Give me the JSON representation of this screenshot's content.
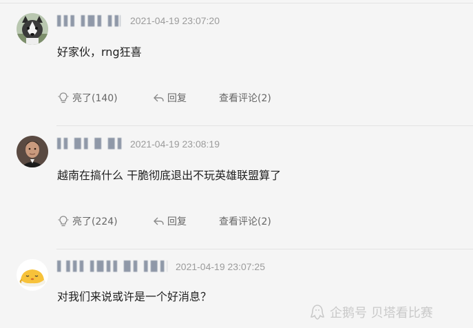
{
  "comments": [
    {
      "username": "▌▌▌▐▐▌▌▐▐ ▌ ▐",
      "time": "2021-04-19 23:07:20",
      "content": "好家伙，rng狂喜",
      "like_label": "亮了(140)",
      "reply_label": "回复",
      "view_comments_label": "查看评论(2)",
      "avatar": "husky-dog-avatar"
    },
    {
      "username": "▌▌▐▌▌▐▌▐▌▌▐▐▐",
      "time": "2021-04-19 23:08:19",
      "content": "越南在搞什么 干脆彻底退出不玩英雄联盟算了",
      "like_label": "亮了(224)",
      "reply_label": "回复",
      "view_comments_label": "查看评论(2)",
      "avatar": "ronaldo-photo-avatar"
    },
    {
      "username": "▌ ▌▌▌▐▐▌▌▌▐▌▌▐▐▌▌▌",
      "time": "2021-04-19 23:07:25",
      "content": "对我们来说或许是一个好消息？",
      "avatar": "gudetama-egg-avatar"
    }
  ],
  "watermark": {
    "text": "企鹅号 贝塔看比赛",
    "icon": "penguin-icon"
  },
  "colors": {
    "background": "#f5f5f5",
    "text": "#1f1f1f",
    "meta": "#9b9b9b",
    "action": "#666666",
    "divider": "#e3e3e3"
  }
}
